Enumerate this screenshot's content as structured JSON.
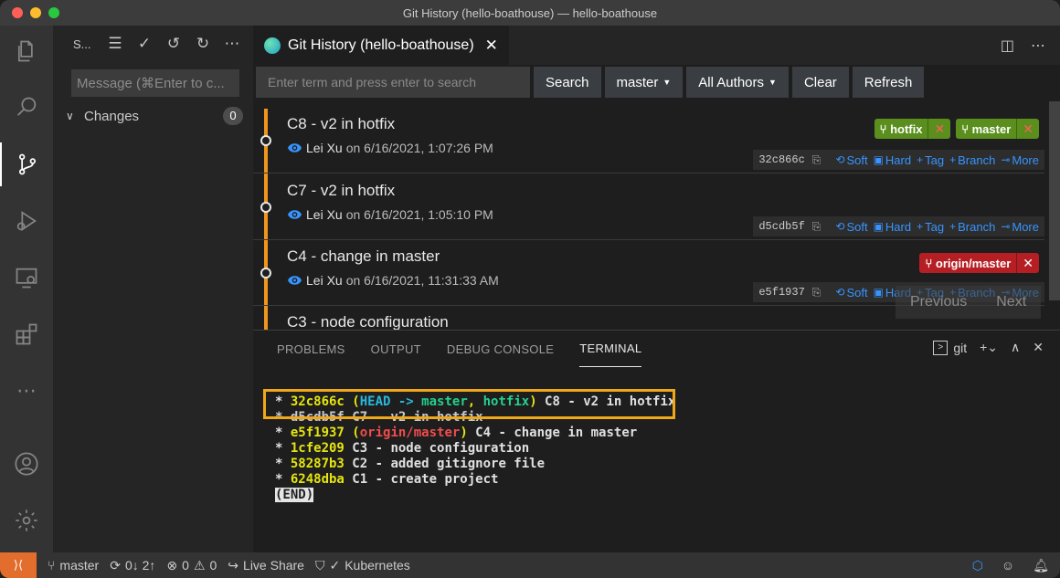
{
  "window": {
    "title": "Git History (hello-boathouse) — hello-boathouse"
  },
  "sidebar": {
    "title": "S...",
    "message_placeholder": "Message (⌘Enter to c...",
    "changes_label": "Changes",
    "changes_count": "0"
  },
  "tab": {
    "label": "Git History (hello-boathouse)",
    "close": "✕"
  },
  "toolbar": {
    "search_placeholder": "Enter term and press enter to search",
    "search_button": "Search",
    "branch_select": "master",
    "author_select": "All Authors",
    "clear_button": "Clear",
    "refresh_button": "Refresh"
  },
  "commits": [
    {
      "title": "C8 - v2 in hotfix",
      "author": "Lei Xu",
      "date_prefix": "on",
      "date": "6/16/2021, 1:07:26 PM",
      "hash": "32c866c",
      "badges": [
        {
          "label": "hotfix",
          "color": "#5a8f1d"
        },
        {
          "label": "master",
          "color": "#5a8f1d"
        }
      ]
    },
    {
      "title": "C7 - v2 in hotfix",
      "author": "Lei Xu",
      "date_prefix": "on",
      "date": "6/16/2021, 1:05:10 PM",
      "hash": "d5cdb5f",
      "badges": []
    },
    {
      "title": "C4 - change in master",
      "author": "Lei Xu",
      "date_prefix": "on",
      "date": "6/16/2021, 11:31:33 AM",
      "hash": "e5f1937",
      "badges": [
        {
          "label": "origin/master",
          "color": "#b51f24"
        }
      ]
    },
    {
      "title": "C3 - node configuration"
    }
  ],
  "commit_actions": {
    "soft": "Soft",
    "hard": "Hard",
    "tag": "Tag",
    "branch": "Branch",
    "more": "More"
  },
  "pager": {
    "previous": "Previous",
    "next": "Next"
  },
  "panel": {
    "tabs": [
      "PROBLEMS",
      "OUTPUT",
      "DEBUG CONSOLE",
      "TERMINAL"
    ],
    "active_tab": "TERMINAL",
    "terminal_name": "git"
  },
  "terminal": {
    "line1": {
      "star": "* ",
      "hash": "32c866c",
      "open": " (",
      "head": "HEAD -> ",
      "master": "master",
      "sep": ", ",
      "hotfix": "hotfix",
      "close": ")",
      "msg": " C8 - v2 in hotfix"
    },
    "line2": {
      "text": "* d5cdb5f C7 - v2 in hotfix"
    },
    "line3": {
      "star": "* ",
      "hash": "e5f1937",
      "open": " (",
      "ref": "origin/master",
      "close": ")",
      "msg": " C4 - change in master"
    },
    "line4": {
      "star": "* ",
      "hash": "1cfe209",
      "msg": " C3 - node configuration"
    },
    "line5": {
      "star": "* ",
      "hash": "58287b3",
      "msg": " C2 - added gitignore file"
    },
    "line6": {
      "star": "* ",
      "hash": "6248dba",
      "msg": " C1 - create project"
    },
    "end": "(END)"
  },
  "statusbar": {
    "branch": "master",
    "sync": "0↓ 2↑",
    "errors": "0",
    "warnings": "0",
    "live_share": "Live Share",
    "kubernetes": "Kubernetes"
  },
  "colors": {
    "accent_orange": "#f0951d",
    "highlight_box": "#f0a818",
    "remote_button": "#e36d2d",
    "link_blue": "#3794ff"
  }
}
